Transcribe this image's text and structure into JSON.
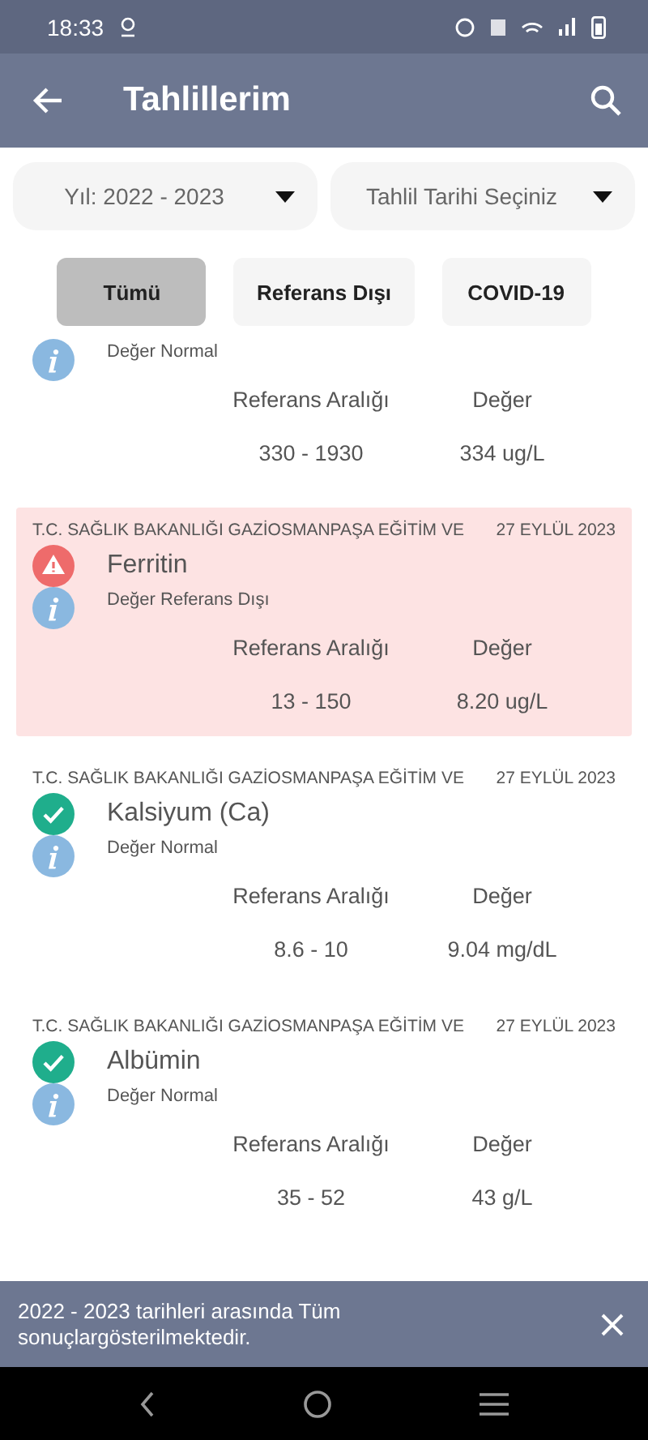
{
  "status_bar": {
    "time": "18:33"
  },
  "app_bar": {
    "title": "Tahlillerim"
  },
  "filters": [
    {
      "label": "Yıl: 2022 - 2023"
    },
    {
      "label": "Tahlil Tarihi Seçiniz"
    }
  ],
  "chips": [
    {
      "label": "Tümü",
      "selected": true
    },
    {
      "label": "Referans Dışı",
      "selected": false
    },
    {
      "label": "COVID-19",
      "selected": false
    }
  ],
  "results": [
    {
      "note": "Değer Normal",
      "range_label": "Referans Aralığı",
      "value_label": "Değer",
      "range": "330 - 1930",
      "value": "334 ug/L",
      "highlighted": false
    },
    {
      "hospital": "T.C. SAĞLIK BAKANLIĞI GAZİOSMANPAŞA EĞİTİM VE",
      "date": "27 EYLÜL 2023",
      "kind": "abnormal",
      "name": "Ferritin",
      "note": "Değer Referans Dışı",
      "range_label": "Referans Aralığı",
      "value_label": "Değer",
      "range": "13 - 150",
      "value": "8.20 ug/L",
      "highlighted": true
    },
    {
      "hospital": "T.C. SAĞLIK BAKANLIĞI GAZİOSMANPAŞA EĞİTİM VE",
      "date": "27 EYLÜL 2023",
      "kind": "normal",
      "name": "Kalsiyum (Ca)",
      "note": "Değer Normal",
      "range_label": "Referans Aralığı",
      "value_label": "Değer",
      "range": "8.6 - 10",
      "value": "9.04 mg/dL",
      "highlighted": false
    },
    {
      "hospital": "T.C. SAĞLIK BAKANLIĞI GAZİOSMANPAŞA EĞİTİM VE",
      "date": "27 EYLÜL 2023",
      "kind": "normal",
      "name": "Albümin",
      "note": "Değer Normal",
      "range_label": "Referans Aralığı",
      "value_label": "Değer",
      "range": "35 - 52",
      "value": "43 g/L",
      "highlighted": false
    }
  ],
  "snackbar": {
    "message": "2022 - 2023 tarihleri arasında Tüm sonuçlargösterilmektedir."
  }
}
